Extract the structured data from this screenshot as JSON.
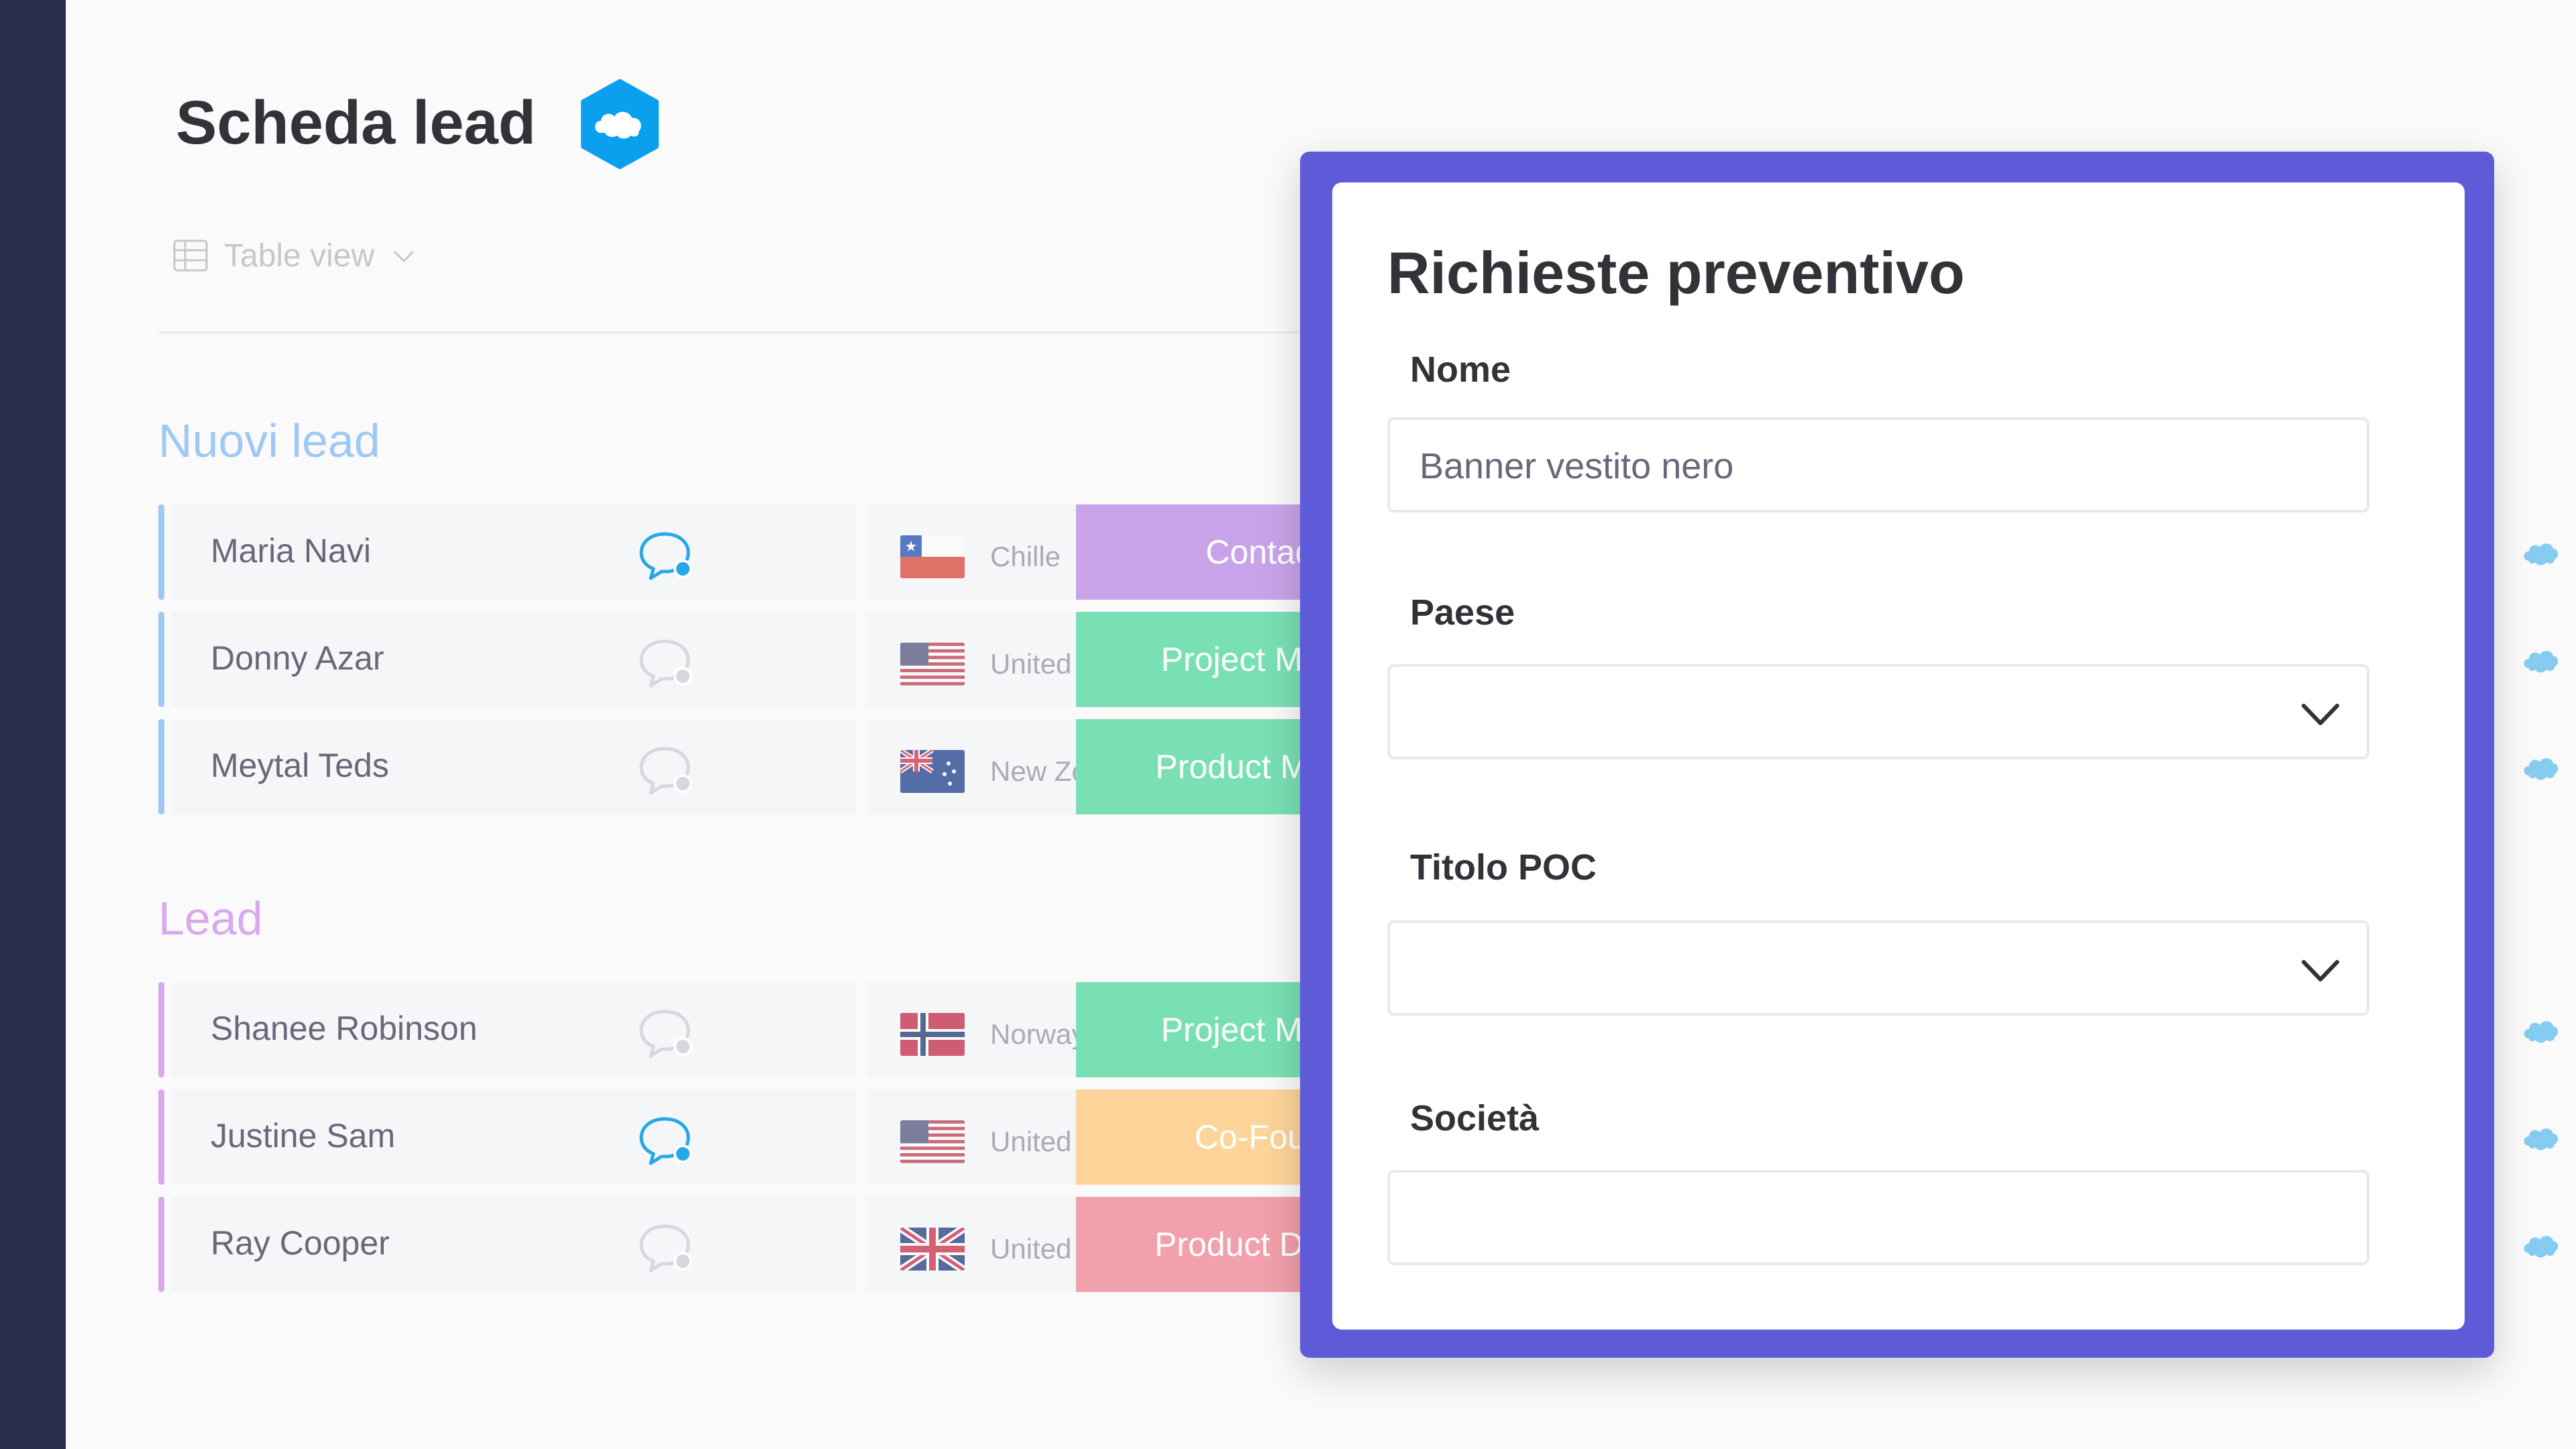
{
  "board": {
    "title": "Scheda lead",
    "view_selector": {
      "label": "Table view",
      "icon": "table-icon"
    },
    "groups": [
      {
        "title": "Nuovi lead",
        "color": "#9ec8f6",
        "rows": [
          {
            "name": "Maria Navi",
            "chat_active": true,
            "country": "Chille",
            "flag": "chile-flag",
            "poc_title": "Contadore",
            "status_color": "#c9a3ea"
          },
          {
            "name": "Donny Azar",
            "chat_active": false,
            "country": "United States",
            "flag": "us-flag",
            "poc_title": "Project Manager",
            "status_color": "#79e0b4"
          },
          {
            "name": "Meytal Teds",
            "chat_active": false,
            "country": "New Zealand",
            "flag": "nz-flag",
            "poc_title": "Product Manager",
            "status_color": "#79e0b4"
          }
        ]
      },
      {
        "title": "Lead",
        "color": "#d9a9ec",
        "rows": [
          {
            "name": "Shanee Robinson",
            "chat_active": false,
            "country": "Norway",
            "flag": "norway-flag",
            "poc_title": "Project Manager",
            "status_color": "#79e0b4"
          },
          {
            "name": "Justine Sam",
            "chat_active": true,
            "country": "United States",
            "flag": "us-flag",
            "poc_title": "Co-Founder",
            "status_color": "#fdd49a"
          },
          {
            "name": "Ray Cooper",
            "chat_active": false,
            "country": "United Kingd...",
            "flag": "uk-flag",
            "poc_title": "Product Designer",
            "status_color": "#f2a0ab"
          }
        ]
      }
    ]
  },
  "form": {
    "title": "Richieste preventivo",
    "fields": [
      {
        "label": "Nome",
        "type": "text",
        "value": "Banner vestito nero"
      },
      {
        "label": "Paese",
        "type": "select",
        "value": ""
      },
      {
        "label": "Titolo POC",
        "type": "select",
        "value": ""
      },
      {
        "label": "Società",
        "type": "text",
        "value": ""
      }
    ]
  },
  "colors": {
    "accent": "#5f5ad8",
    "sidebar": "#292f4c",
    "salesforce": "#0ea5e9"
  }
}
